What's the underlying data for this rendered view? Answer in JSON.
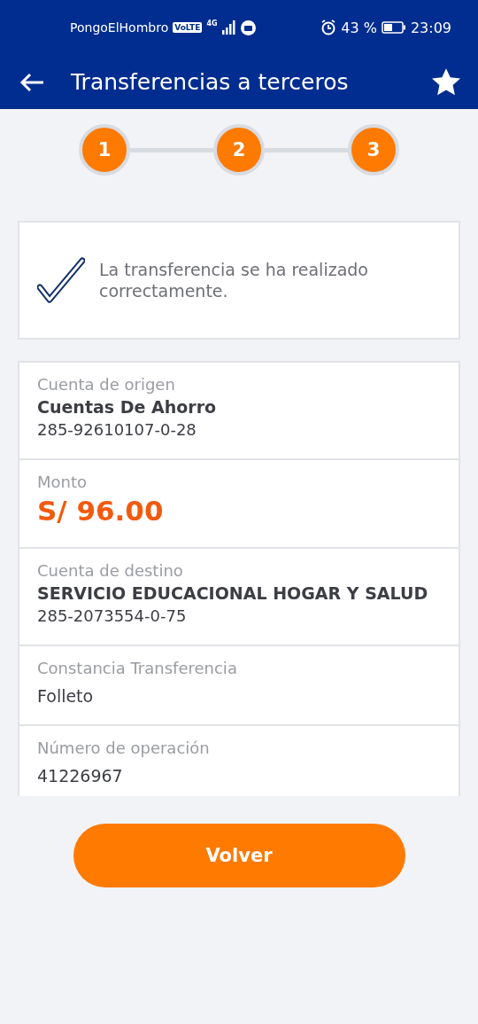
{
  "status_bar": {
    "carrier": "PongoElHombro",
    "volte": "VoLTE",
    "network": "4G",
    "battery": "43 %",
    "time": "23:09"
  },
  "app_bar": {
    "title": "Transferencias a terceros"
  },
  "steps": [
    {
      "label": "1",
      "completed": true
    },
    {
      "label": "2",
      "completed": true
    },
    {
      "label": "3",
      "completed": true
    }
  ],
  "message": "La transferencia se ha realizado correctamente.",
  "details": [
    {
      "kind": "account",
      "label": "Cuenta de origen",
      "value": "Cuentas De Ahorro",
      "number": "285-92610107-0-28"
    },
    {
      "kind": "amount",
      "label": "Monto",
      "value": "S/ 96.00"
    },
    {
      "kind": "account",
      "label": "Cuenta de destino",
      "value": "SERVICIO EDUCACIONAL HOGAR Y SALUD",
      "number": "285-2073554-0-75"
    },
    {
      "kind": "text",
      "label": "Constancia Transferencia",
      "value": "Folleto"
    },
    {
      "kind": "text",
      "label": "Número de operación",
      "value": "41226967"
    }
  ],
  "button": "Volver"
}
